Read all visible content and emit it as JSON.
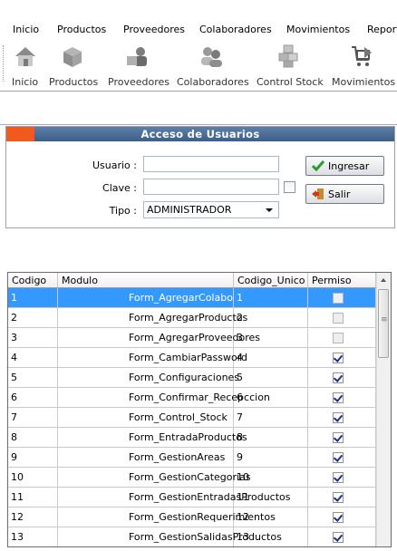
{
  "menu": [
    "Inicio",
    "Productos",
    "Proveedores",
    "Colaboradores",
    "Movimientos",
    "Report"
  ],
  "toolbar": [
    {
      "label": "Inicio",
      "icon": "home-icon"
    },
    {
      "label": "Productos",
      "icon": "box-icon"
    },
    {
      "label": "Proveedores",
      "icon": "supplier-icon"
    },
    {
      "label": "Colaboradores",
      "icon": "users-icon"
    },
    {
      "label": "Control Stock",
      "icon": "stock-boxes-icon"
    },
    {
      "label": "Movimientos",
      "icon": "cart-arrow-icon"
    }
  ],
  "login": {
    "title": "Acceso de Usuarios",
    "usuario_label": "Usuario :",
    "usuario_value": "",
    "clave_label": "Clave :",
    "clave_value": "",
    "tipo_label": "Tipo :",
    "tipo_value": "ADMINISTRADOR",
    "ingresar_label": "Ingresar",
    "salir_label": "Salir"
  },
  "table": {
    "columns": [
      "Codigo",
      "Modulo",
      "Codigo_Unico",
      "Permiso"
    ],
    "rows": [
      {
        "codigo": "1",
        "modulo": "Form_AgregarColaboradores",
        "codigo_unico": "1",
        "permiso": false
      },
      {
        "codigo": "2",
        "modulo": "Form_AgregarProductos",
        "codigo_unico": "2",
        "permiso": false
      },
      {
        "codigo": "3",
        "modulo": "Form_AgregarProveedores",
        "codigo_unico": "3",
        "permiso": false
      },
      {
        "codigo": "4",
        "modulo": "Form_CambiarPassword",
        "codigo_unico": "4",
        "permiso": true
      },
      {
        "codigo": "5",
        "modulo": "Form_Configuraciones",
        "codigo_unico": "5",
        "permiso": true
      },
      {
        "codigo": "6",
        "modulo": "Form_Confirmar_Recepccion",
        "codigo_unico": "6",
        "permiso": true
      },
      {
        "codigo": "7",
        "modulo": "Form_Control_Stock",
        "codigo_unico": "7",
        "permiso": true
      },
      {
        "codigo": "8",
        "modulo": "Form_EntradaProductos",
        "codigo_unico": "8",
        "permiso": true
      },
      {
        "codigo": "9",
        "modulo": "Form_GestionAreas",
        "codigo_unico": "9",
        "permiso": true
      },
      {
        "codigo": "10",
        "modulo": "Form_GestionCategorias",
        "codigo_unico": "10",
        "permiso": true
      },
      {
        "codigo": "11",
        "modulo": "Form_GestionEntradasProductos",
        "codigo_unico": "11",
        "permiso": true
      },
      {
        "codigo": "12",
        "modulo": "Form_GestionRequerimientos",
        "codigo_unico": "12",
        "permiso": true
      },
      {
        "codigo": "13",
        "modulo": "Form_GestionSalidasProductos",
        "codigo_unico": "13",
        "permiso": true
      }
    ],
    "selected_row": 0
  },
  "colors": {
    "title_bar": "#4a6d96",
    "title_accent": "#f05a1e",
    "selection": "#3399ff"
  }
}
